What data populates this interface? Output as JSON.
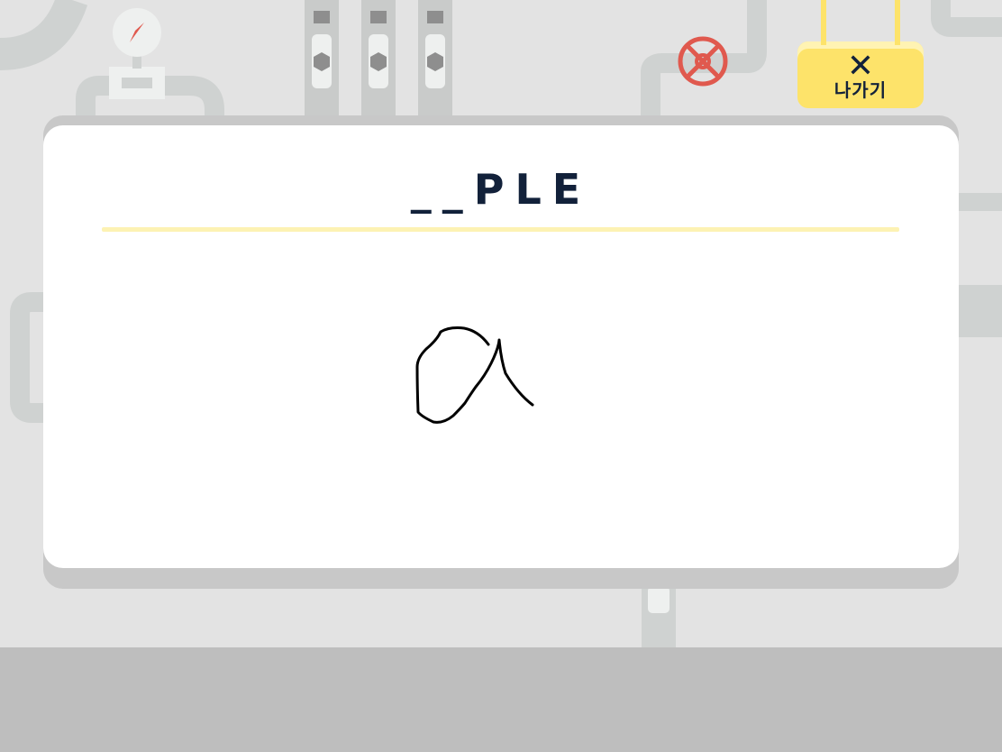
{
  "game": {
    "word_prompt": "__PLE",
    "exit_button": {
      "label": "나가기",
      "icon": "close-icon",
      "icon_glyph": "✕",
      "color": "#fde36a"
    },
    "drawing": {
      "description_icon": "handwriting-stroke",
      "stroke_color": "#000000"
    },
    "colors": {
      "text": "#12213a",
      "accent": "#fde36a",
      "valve": "#e0594e",
      "compass_needle": "#e0594e"
    }
  }
}
